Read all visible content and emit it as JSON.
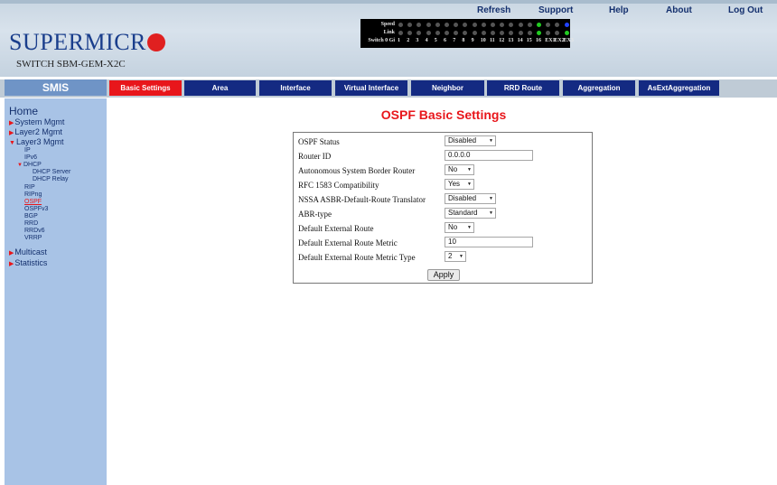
{
  "brand": {
    "logo_text": "SUPERMICR",
    "switch_name": "SWITCH SBM-GEM-X2C"
  },
  "top_links": [
    "Refresh",
    "Support",
    "Help",
    "About",
    "Log Out"
  ],
  "port_status": {
    "speed_label": "Speed",
    "link_label": "Link",
    "ports_label": "Switch 0 Gi",
    "port_numbers": [
      "1",
      "2",
      "3",
      "4",
      "5",
      "6",
      "7",
      "8",
      "9",
      "10",
      "11",
      "12",
      "13",
      "14",
      "15",
      "16",
      "EX1",
      "EX2",
      "EX3"
    ],
    "speed_leds": [
      "off",
      "off",
      "off",
      "off",
      "off",
      "off",
      "off",
      "off",
      "off",
      "off",
      "off",
      "off",
      "off",
      "off",
      "off",
      "green",
      "off",
      "off",
      "blue"
    ],
    "link_leds": [
      "off",
      "off",
      "off",
      "off",
      "off",
      "off",
      "off",
      "off",
      "off",
      "off",
      "off",
      "off",
      "off",
      "off",
      "off",
      "green",
      "off",
      "off",
      "green"
    ],
    "colors": {
      "off": "#555555",
      "green": "#22cc22",
      "blue": "#2244ff"
    }
  },
  "nav": {
    "section": "SMIS",
    "tabs": [
      "Basic Settings",
      "Area",
      "Interface",
      "Virtual Interface",
      "Neighbor",
      "RRD Route",
      "Aggregation",
      "AsExtAggregation"
    ],
    "active_tab": "Basic Settings"
  },
  "sidebar": {
    "home": "Home",
    "system_mgmt": "System Mgmt",
    "layer2_mgmt": "Layer2 Mgmt",
    "layer3_mgmt": "Layer3 Mgmt",
    "layer3_items": [
      "IP",
      "IPv6",
      "DHCP",
      "DHCP Server",
      "DHCP Relay",
      "RIP",
      "RIPng",
      "OSPF",
      "OSPFv3",
      "BGP",
      "RRD",
      "RRDv6",
      "VRRP"
    ],
    "multicast": "Multicast",
    "statistics": "Statistics",
    "active_item": "OSPF"
  },
  "page": {
    "title": "OSPF Basic Settings"
  },
  "form": {
    "ospf_status": {
      "label": "OSPF Status",
      "value": "Disabled"
    },
    "router_id": {
      "label": "Router ID",
      "value": "0.0.0.0"
    },
    "asbr": {
      "label": "Autonomous System Border Router",
      "value": "No"
    },
    "rfc1583": {
      "label": "RFC 1583 Compatibility",
      "value": "Yes"
    },
    "nssa": {
      "label": "NSSA ASBR-Default-Route Translator",
      "value": "Disabled"
    },
    "abr_type": {
      "label": "ABR-type",
      "value": "Standard"
    },
    "default_ext_route": {
      "label": "Default External Route",
      "value": "No"
    },
    "default_ext_metric": {
      "label": "Default External Route Metric",
      "value": "10"
    },
    "default_ext_metric_type": {
      "label": "Default External Route Metric Type",
      "value": "2"
    },
    "apply_label": "Apply"
  },
  "colors": {
    "accent_red": "#e8161b",
    "nav_blue": "#142a82",
    "sidebar_bg": "#a8c3e6",
    "smis_bg": "#6f94c6",
    "link_blue": "#14306e"
  }
}
